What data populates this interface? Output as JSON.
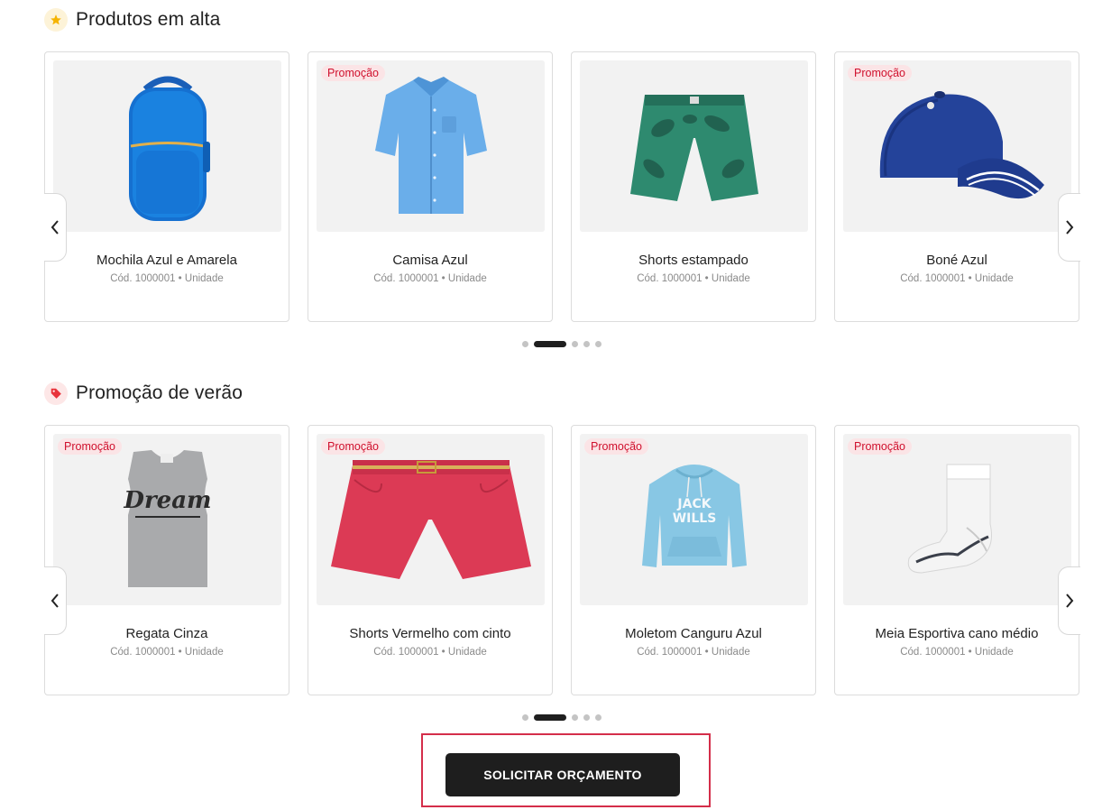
{
  "sections": [
    {
      "title": "Produtos em alta",
      "icon": "star-icon",
      "products": [
        {
          "name": "Mochila Azul e Amarela",
          "meta": "Cód. 1000001 • Unidade",
          "badge": "",
          "image": "backpack-image"
        },
        {
          "name": "Camisa Azul",
          "meta": "Cód. 1000001 • Unidade",
          "badge": "Promoção",
          "image": "shirt-image"
        },
        {
          "name": "Shorts estampado",
          "meta": "Cód. 1000001 • Unidade",
          "badge": "",
          "image": "printed-shorts-image"
        },
        {
          "name": "Boné Azul",
          "meta": "Cód. 1000001 • Unidade",
          "badge": "Promoção",
          "image": "cap-image"
        }
      ],
      "pagination": {
        "pages": 5,
        "active": 2
      }
    },
    {
      "title": "Promoção de verão",
      "icon": "tag-icon",
      "products": [
        {
          "name": "Regata Cinza",
          "meta": "Cód. 1000001 • Unidade",
          "badge": "Promoção",
          "image": "tank-top-image"
        },
        {
          "name": "Shorts Vermelho com cinto",
          "meta": "Cód. 1000001 • Unidade",
          "badge": "Promoção",
          "image": "red-shorts-image"
        },
        {
          "name": "Moletom Canguru Azul",
          "meta": "Cód. 1000001 • Unidade",
          "badge": "Promoção",
          "image": "hoodie-image"
        },
        {
          "name": "Meia Esportiva cano médio",
          "meta": "Cód. 1000001 • Unidade",
          "badge": "Promoção",
          "image": "sock-image"
        }
      ],
      "pagination": {
        "pages": 5,
        "active": 2
      }
    }
  ],
  "cta": {
    "label": "SOLICITAR ORÇAMENTO"
  },
  "colors": {
    "badge_text": "#d0102d",
    "badge_bg": "#fbe4e6",
    "cta_bg": "#1e1e1e",
    "highlight_border": "#d42e4a",
    "star": "#f5b301",
    "tag": "#e8333b"
  }
}
